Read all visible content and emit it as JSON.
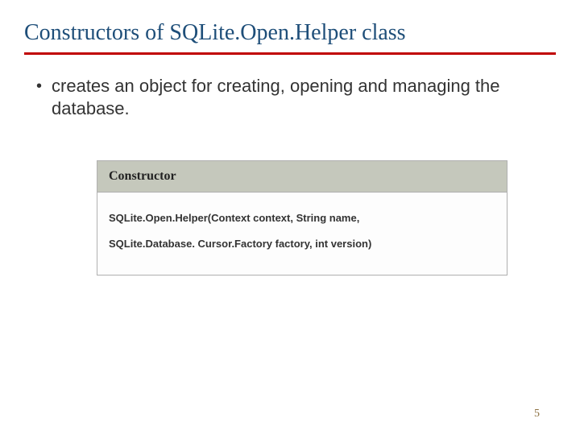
{
  "slide": {
    "title": "Constructors of SQLite.Open.Helper class",
    "bullet": "creates an object for creating, opening and managing the database.",
    "codebox": {
      "header": "Constructor",
      "line1": "SQLite.Open.Helper(Context context, String name,",
      "line2": "SQLite.Database. Cursor.Factory factory, int version)"
    },
    "page_number": "5"
  }
}
